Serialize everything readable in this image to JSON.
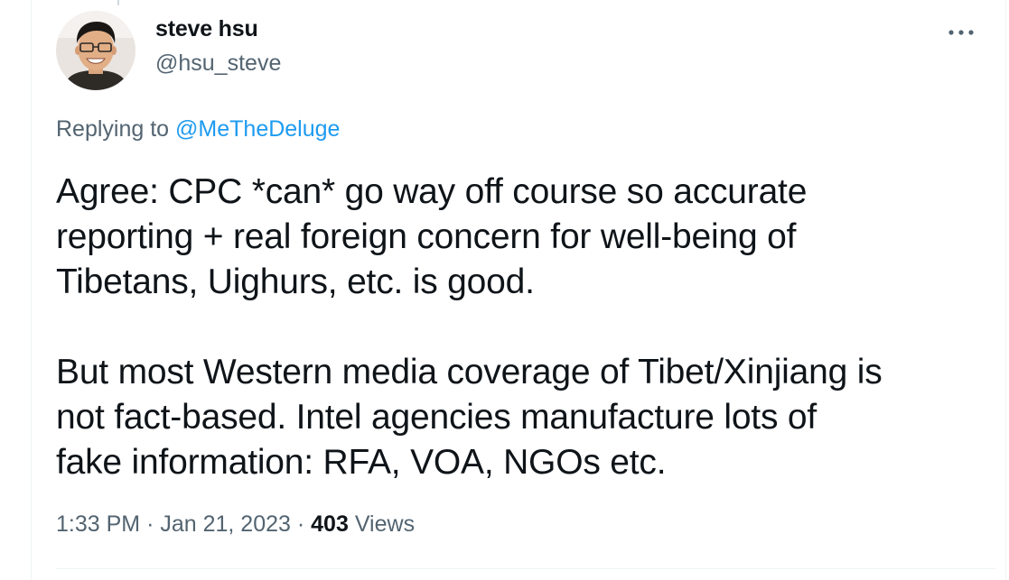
{
  "author": {
    "name": "steve hsu",
    "handle": "@hsu_steve",
    "avatar_icon": "profile-photo"
  },
  "more_icon": "ellipsis-icon",
  "reply": {
    "prefix": "Replying to",
    "mention": "@MeTheDeluge"
  },
  "tweet": {
    "paragraphs": [
      "Agree: CPC *can* go way off course so accurate\nreporting + real foreign concern for well-being of\nTibetans, Uighurs, etc. is good.",
      "But most Western media coverage of Tibet/Xinjiang is\nnot fact-based. Intel agencies manufacture lots of\nfake information: RFA, VOA, NGOs etc."
    ]
  },
  "meta": {
    "time": "1:33 PM",
    "separator": "·",
    "date": "Jan 21, 2023",
    "views_count": "403",
    "views_label": "Views"
  },
  "colors": {
    "text": "#0f1419",
    "secondary": "#536471",
    "link": "#1d9bf0",
    "divider": "#eff3f4"
  }
}
